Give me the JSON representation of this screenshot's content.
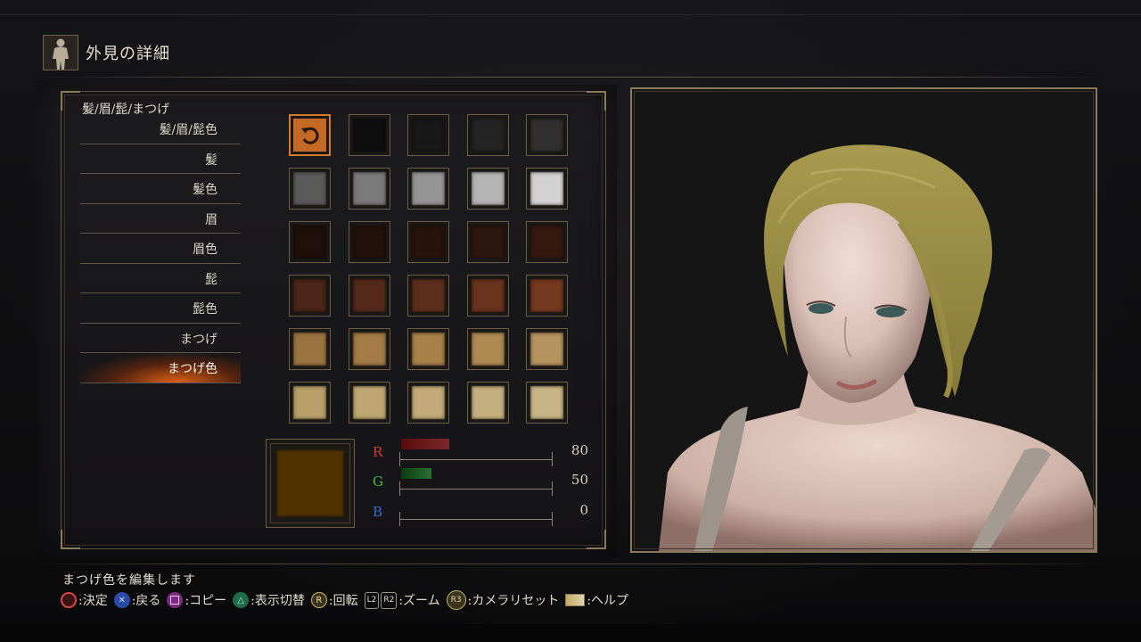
{
  "header": {
    "title": "外見の詳細",
    "icon": "body-silhouette-icon"
  },
  "menu": {
    "heading": "髪/眉/髭/まつげ",
    "items": [
      {
        "label": "髪/眉/髭色"
      },
      {
        "label": "髪"
      },
      {
        "label": "髪色"
      },
      {
        "label": "眉"
      },
      {
        "label": "眉色"
      },
      {
        "label": "髭"
      },
      {
        "label": "髭色"
      },
      {
        "label": "まつげ"
      },
      {
        "label": "まつげ色",
        "selected": true
      }
    ]
  },
  "palette": {
    "reset_icon": "reset-arrow-icon",
    "colors": [
      "RESET",
      "#0e0e0e",
      "#181818",
      "#242424",
      "#2f2f2f",
      "#5a5a5a",
      "#7a7a7a",
      "#959595",
      "#b4b4b4",
      "#d2d2d2",
      "#1e0f0b",
      "#22100a",
      "#27130c",
      "#2d160d",
      "#35190f",
      "#4b2619",
      "#54291a",
      "#5e2e1c",
      "#69331e",
      "#74391f",
      "#9a7440",
      "#a27b45",
      "#a8814a",
      "#ae8a53",
      "#b5935e",
      "#b8a06a",
      "#bea772",
      "#c2ab78",
      "#c4b07e",
      "#c8b585"
    ]
  },
  "current_color": {
    "hex": "#503200"
  },
  "sliders": [
    {
      "label": "R",
      "value": "80",
      "label_color": "#d83a3a",
      "fill_color": "#5a0c0c"
    },
    {
      "label": "G",
      "value": "50",
      "label_color": "#3ac04a",
      "fill_color": "#0a3d12"
    },
    {
      "label": "B",
      "value": "0",
      "label_color": "#3a6ad8",
      "fill_color": "#0a1640"
    }
  ],
  "footer": {
    "description": "まつげ色を編集します",
    "controls": [
      {
        "button": "○",
        "label": ":決定"
      },
      {
        "button": "×",
        "label": ":戻る"
      },
      {
        "button": "□",
        "label": ":コピー"
      },
      {
        "button": "△",
        "label": ":表示切替"
      },
      {
        "button": "R",
        "label": ":回転"
      },
      {
        "button": "L2 R2",
        "label": ":ズーム"
      },
      {
        "button": "R3",
        "label": ":カメラリセット"
      },
      {
        "button": "touchpad",
        "label": ":ヘルプ"
      }
    ]
  }
}
